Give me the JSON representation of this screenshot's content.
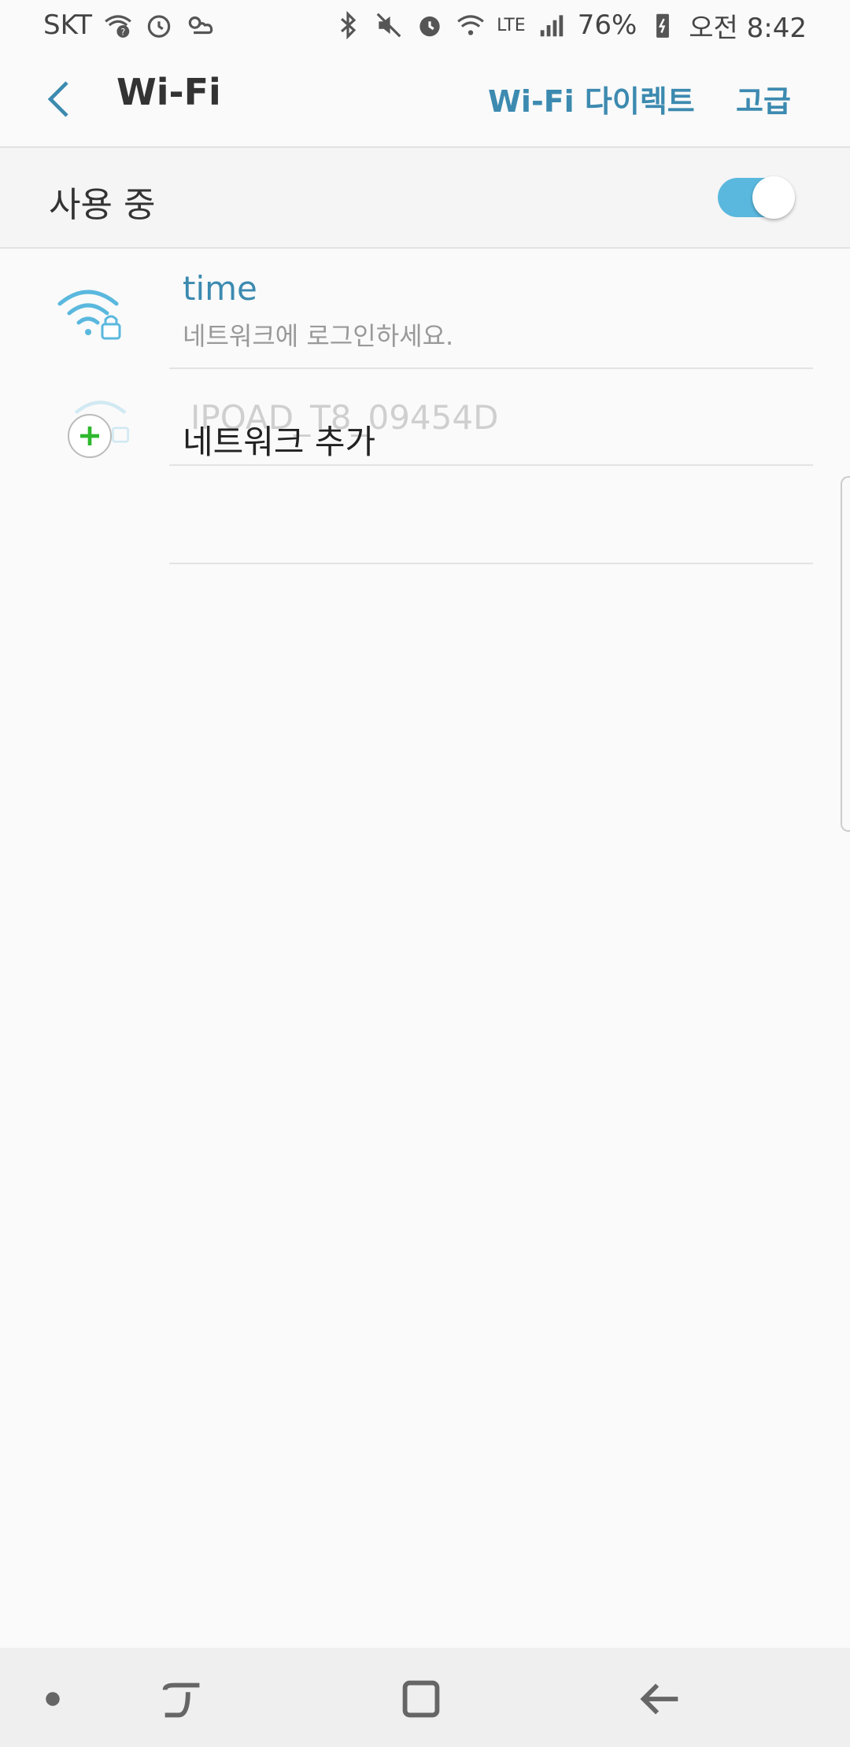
{
  "status_bar": {
    "carrier": "SKT",
    "network": "LTE",
    "battery": "76%",
    "time": "오전 8:42",
    "icons": [
      "wifi-question-icon",
      "alarm-icon",
      "weather-icon",
      "bluetooth-icon",
      "mute-icon",
      "alarm-clock-icon",
      "wifi-icon",
      "signal-icon",
      "battery-icon"
    ]
  },
  "app_bar": {
    "title": "Wi-Fi",
    "actions": {
      "direct": "Wi-Fi 다이렉트",
      "advanced": "고급"
    }
  },
  "master_switch": {
    "label": "사용 중",
    "on": true
  },
  "networks": [
    {
      "name": "time",
      "status": "네트워크에 로그인하세요.",
      "secured": true
    }
  ],
  "ghost_network": {
    "name": "IPOAD_T8_09454D"
  },
  "add_network": {
    "label": "네트워크 추가"
  },
  "colors": {
    "accent": "#3c8ab0",
    "toggle": "#5ab8de",
    "add": "#2eb82e"
  }
}
